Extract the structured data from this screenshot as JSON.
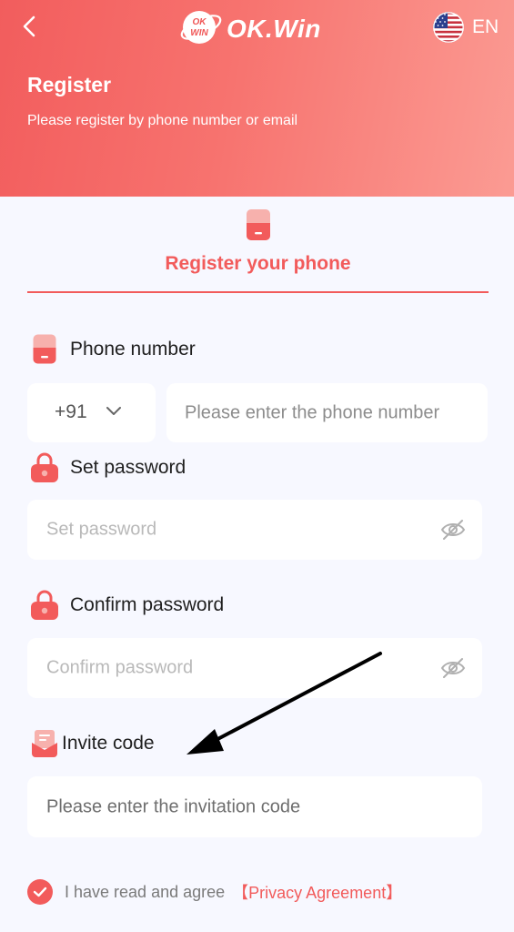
{
  "header": {
    "logo_badge_text": "OK WIN",
    "logo_text": "OK.Win",
    "language": "EN",
    "title": "Register",
    "subtitle": "Please register by phone number or email"
  },
  "tab": {
    "label": "Register your phone"
  },
  "form": {
    "phone_label": "Phone number",
    "country_code": "+91",
    "phone_placeholder": "Please enter the phone number",
    "password_label": "Set password",
    "password_placeholder": "Set password",
    "confirm_label": "Confirm password",
    "confirm_placeholder": "Confirm password",
    "invite_label": "Invite code",
    "invite_placeholder": "Please enter the invitation code"
  },
  "agreement": {
    "checked": true,
    "text": "I have read and agree",
    "link": "【Privacy Agreement】"
  },
  "colors": {
    "accent": "#f25b5b",
    "header_gradient_start": "#f25d5d",
    "header_gradient_end": "#fb9b93",
    "page_bg": "#f7f8ff"
  }
}
